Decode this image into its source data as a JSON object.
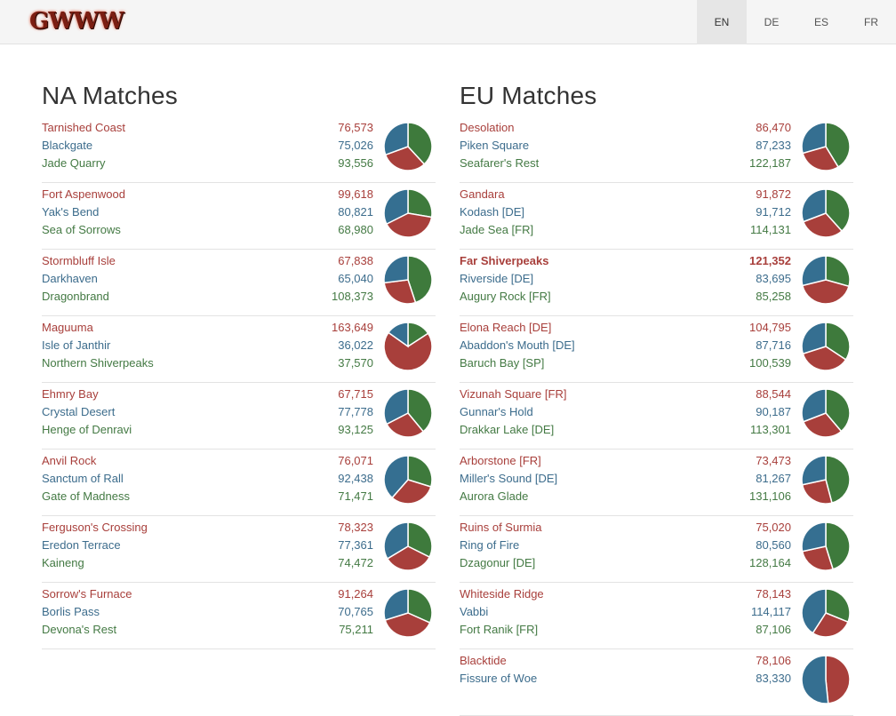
{
  "header": {
    "logo": "GWWW",
    "languages": [
      "EN",
      "DE",
      "ES",
      "FR"
    ],
    "active_language": "EN"
  },
  "colors": {
    "red": "#a83f3b",
    "blue": "#356f91",
    "green": "#3e7a3c"
  },
  "na": {
    "title": "NA Matches",
    "matches": [
      {
        "red": {
          "name": "Tarnished Coast",
          "score": "76,573"
        },
        "blue": {
          "name": "Blackgate",
          "score": "75,026"
        },
        "green": {
          "name": "Jade Quarry",
          "score": "93,556"
        }
      },
      {
        "red": {
          "name": "Fort Aspenwood",
          "score": "99,618"
        },
        "blue": {
          "name": "Yak's Bend",
          "score": "80,821"
        },
        "green": {
          "name": "Sea of Sorrows",
          "score": "68,980"
        }
      },
      {
        "red": {
          "name": "Stormbluff Isle",
          "score": "67,838"
        },
        "blue": {
          "name": "Darkhaven",
          "score": "65,040"
        },
        "green": {
          "name": "Dragonbrand",
          "score": "108,373"
        }
      },
      {
        "red": {
          "name": "Maguuma",
          "score": "163,649"
        },
        "blue": {
          "name": "Isle of Janthir",
          "score": "36,022"
        },
        "green": {
          "name": "Northern Shiverpeaks",
          "score": "37,570"
        }
      },
      {
        "red": {
          "name": "Ehmry Bay",
          "score": "67,715"
        },
        "blue": {
          "name": "Crystal Desert",
          "score": "77,778"
        },
        "green": {
          "name": "Henge of Denravi",
          "score": "93,125"
        }
      },
      {
        "red": {
          "name": "Anvil Rock",
          "score": "76,071"
        },
        "blue": {
          "name": "Sanctum of Rall",
          "score": "92,438"
        },
        "green": {
          "name": "Gate of Madness",
          "score": "71,471"
        }
      },
      {
        "red": {
          "name": "Ferguson's Crossing",
          "score": "78,323"
        },
        "blue": {
          "name": "Eredon Terrace",
          "score": "77,361"
        },
        "green": {
          "name": "Kaineng",
          "score": "74,472"
        }
      },
      {
        "red": {
          "name": "Sorrow's Furnace",
          "score": "91,264"
        },
        "blue": {
          "name": "Borlis Pass",
          "score": "70,765"
        },
        "green": {
          "name": "Devona's Rest",
          "score": "75,211"
        }
      }
    ]
  },
  "eu": {
    "title": "EU Matches",
    "matches": [
      {
        "red": {
          "name": "Desolation",
          "score": "86,470"
        },
        "blue": {
          "name": "Piken Square",
          "score": "87,233"
        },
        "green": {
          "name": "Seafarer's Rest",
          "score": "122,187"
        }
      },
      {
        "red": {
          "name": "Gandara",
          "score": "91,872"
        },
        "blue": {
          "name": "Kodash [DE]",
          "score": "91,712"
        },
        "green": {
          "name": "Jade Sea [FR]",
          "score": "114,131"
        }
      },
      {
        "red": {
          "name": "Far Shiverpeaks",
          "score": "121,352",
          "highlight": true
        },
        "blue": {
          "name": "Riverside [DE]",
          "score": "83,695"
        },
        "green": {
          "name": "Augury Rock [FR]",
          "score": "85,258"
        }
      },
      {
        "red": {
          "name": "Elona Reach [DE]",
          "score": "104,795"
        },
        "blue": {
          "name": "Abaddon's Mouth [DE]",
          "score": "87,716"
        },
        "green": {
          "name": "Baruch Bay [SP]",
          "score": "100,539"
        }
      },
      {
        "red": {
          "name": "Vizunah Square [FR]",
          "score": "88,544"
        },
        "blue": {
          "name": "Gunnar's Hold",
          "score": "90,187"
        },
        "green": {
          "name": "Drakkar Lake [DE]",
          "score": "113,301"
        }
      },
      {
        "red": {
          "name": "Arborstone [FR]",
          "score": "73,473"
        },
        "blue": {
          "name": "Miller's Sound [DE]",
          "score": "81,267"
        },
        "green": {
          "name": "Aurora Glade",
          "score": "131,106"
        }
      },
      {
        "red": {
          "name": "Ruins of Surmia",
          "score": "75,020"
        },
        "blue": {
          "name": "Ring of Fire",
          "score": "80,560"
        },
        "green": {
          "name": "Dzagonur [DE]",
          "score": "128,164"
        }
      },
      {
        "red": {
          "name": "Whiteside Ridge",
          "score": "78,143"
        },
        "blue": {
          "name": "Vabbi",
          "score": "114,117"
        },
        "green": {
          "name": "Fort Ranik [FR]",
          "score": "87,106"
        }
      },
      {
        "red": {
          "name": "Blacktide",
          "score": "78,106"
        },
        "blue": {
          "name": "Fissure of Woe",
          "score": "83,330"
        },
        "green": {
          "name": "",
          "score": ""
        }
      }
    ]
  }
}
